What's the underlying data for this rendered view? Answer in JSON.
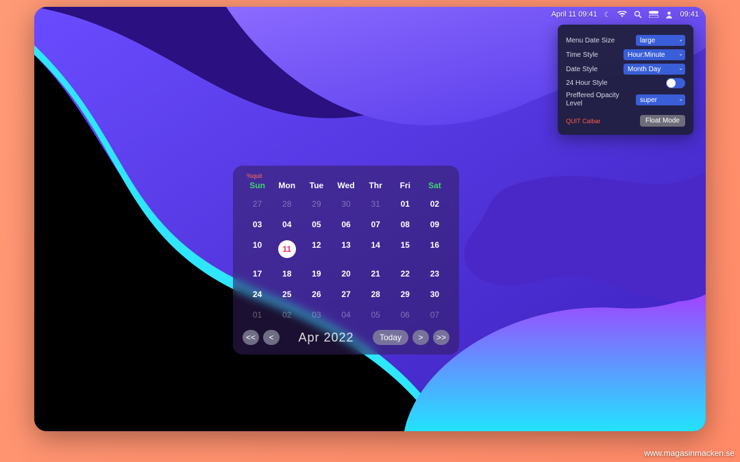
{
  "menubar": {
    "datetime": "April 11 09:41",
    "time_right": "09:41"
  },
  "settings": {
    "rows": {
      "menu_date_size": {
        "label": "Menu Date Size",
        "value": "large"
      },
      "time_style": {
        "label": "Time Style",
        "value": "Hour:Minute"
      },
      "date_style": {
        "label": "Date Style",
        "value": "Month Day"
      },
      "hour24": {
        "label": "24 Hour Style",
        "on": false
      },
      "opacity": {
        "label": "Preffered Opacity Level",
        "value": "super"
      }
    },
    "quit_label": "QUIT Calbar",
    "float_label": "Float Mode"
  },
  "calendar": {
    "tag": "%quit",
    "month_label": "Apr 2022",
    "today_label": "Today",
    "day_headers": [
      "Sun",
      "Mon",
      "Tue",
      "Wed",
      "Thr",
      "Fri",
      "Sat"
    ],
    "weeks": [
      [
        {
          "n": "27",
          "out": true
        },
        {
          "n": "28",
          "out": true
        },
        {
          "n": "29",
          "out": true
        },
        {
          "n": "30",
          "out": true
        },
        {
          "n": "31",
          "out": true
        },
        {
          "n": "01"
        },
        {
          "n": "02"
        }
      ],
      [
        {
          "n": "03"
        },
        {
          "n": "04"
        },
        {
          "n": "05"
        },
        {
          "n": "06"
        },
        {
          "n": "07"
        },
        {
          "n": "08"
        },
        {
          "n": "09"
        }
      ],
      [
        {
          "n": "10"
        },
        {
          "n": "11",
          "today": true
        },
        {
          "n": "12"
        },
        {
          "n": "13"
        },
        {
          "n": "14"
        },
        {
          "n": "15"
        },
        {
          "n": "16"
        }
      ],
      [
        {
          "n": "17"
        },
        {
          "n": "18"
        },
        {
          "n": "19"
        },
        {
          "n": "20"
        },
        {
          "n": "21"
        },
        {
          "n": "22"
        },
        {
          "n": "23"
        }
      ],
      [
        {
          "n": "24"
        },
        {
          "n": "25"
        },
        {
          "n": "26"
        },
        {
          "n": "27"
        },
        {
          "n": "28"
        },
        {
          "n": "29"
        },
        {
          "n": "30"
        }
      ],
      [
        {
          "n": "01",
          "out": true
        },
        {
          "n": "02",
          "out": true
        },
        {
          "n": "03",
          "out": true
        },
        {
          "n": "04",
          "out": true
        },
        {
          "n": "05",
          "out": true
        },
        {
          "n": "06",
          "out": true
        },
        {
          "n": "07",
          "out": true
        }
      ]
    ],
    "nav": {
      "prev_fast": "<<",
      "prev": "<",
      "next": ">",
      "next_fast": ">>"
    }
  },
  "watermark": "www.magasinmacken.se"
}
